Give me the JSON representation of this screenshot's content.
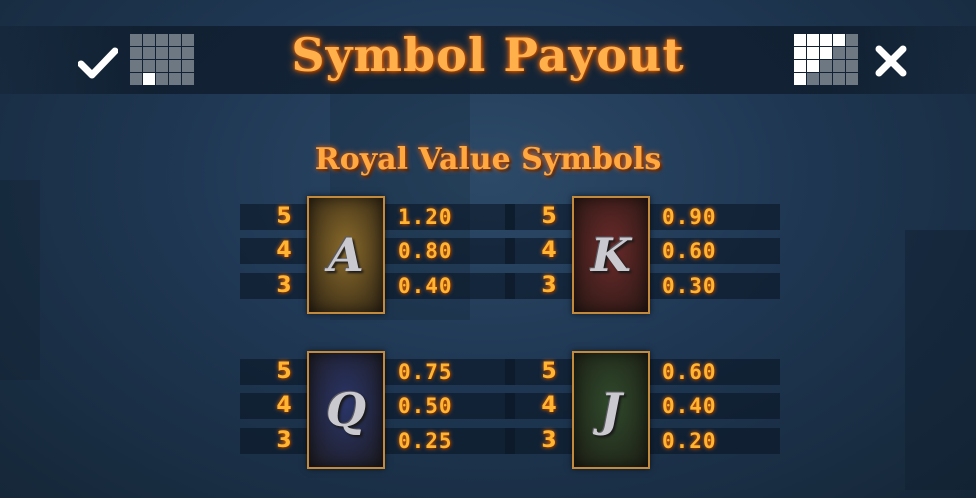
{
  "header": {
    "title": "Symbol Payout",
    "confirm_icon": "check-icon",
    "close_icon": "close-icon",
    "left_grid_icon": "payline-grid-icon",
    "right_grid_icon": "payline-grid-icon"
  },
  "section": {
    "title": "Royal Value Symbols"
  },
  "symbols": [
    {
      "letter": "A",
      "card_color": "#8a6a2a",
      "payouts": [
        {
          "count": "5",
          "value": "1.20"
        },
        {
          "count": "4",
          "value": "0.80"
        },
        {
          "count": "3",
          "value": "0.40"
        }
      ]
    },
    {
      "letter": "K",
      "card_color": "#6a2a2a",
      "payouts": [
        {
          "count": "5",
          "value": "0.90"
        },
        {
          "count": "4",
          "value": "0.60"
        },
        {
          "count": "3",
          "value": "0.30"
        }
      ]
    },
    {
      "letter": "Q",
      "card_color": "#2a3568",
      "payouts": [
        {
          "count": "5",
          "value": "0.75"
        },
        {
          "count": "4",
          "value": "0.50"
        },
        {
          "count": "3",
          "value": "0.25"
        }
      ]
    },
    {
      "letter": "J",
      "card_color": "#2f4a2c",
      "payouts": [
        {
          "count": "5",
          "value": "0.60"
        },
        {
          "count": "4",
          "value": "0.40"
        },
        {
          "count": "3",
          "value": "0.20"
        }
      ]
    }
  ]
}
